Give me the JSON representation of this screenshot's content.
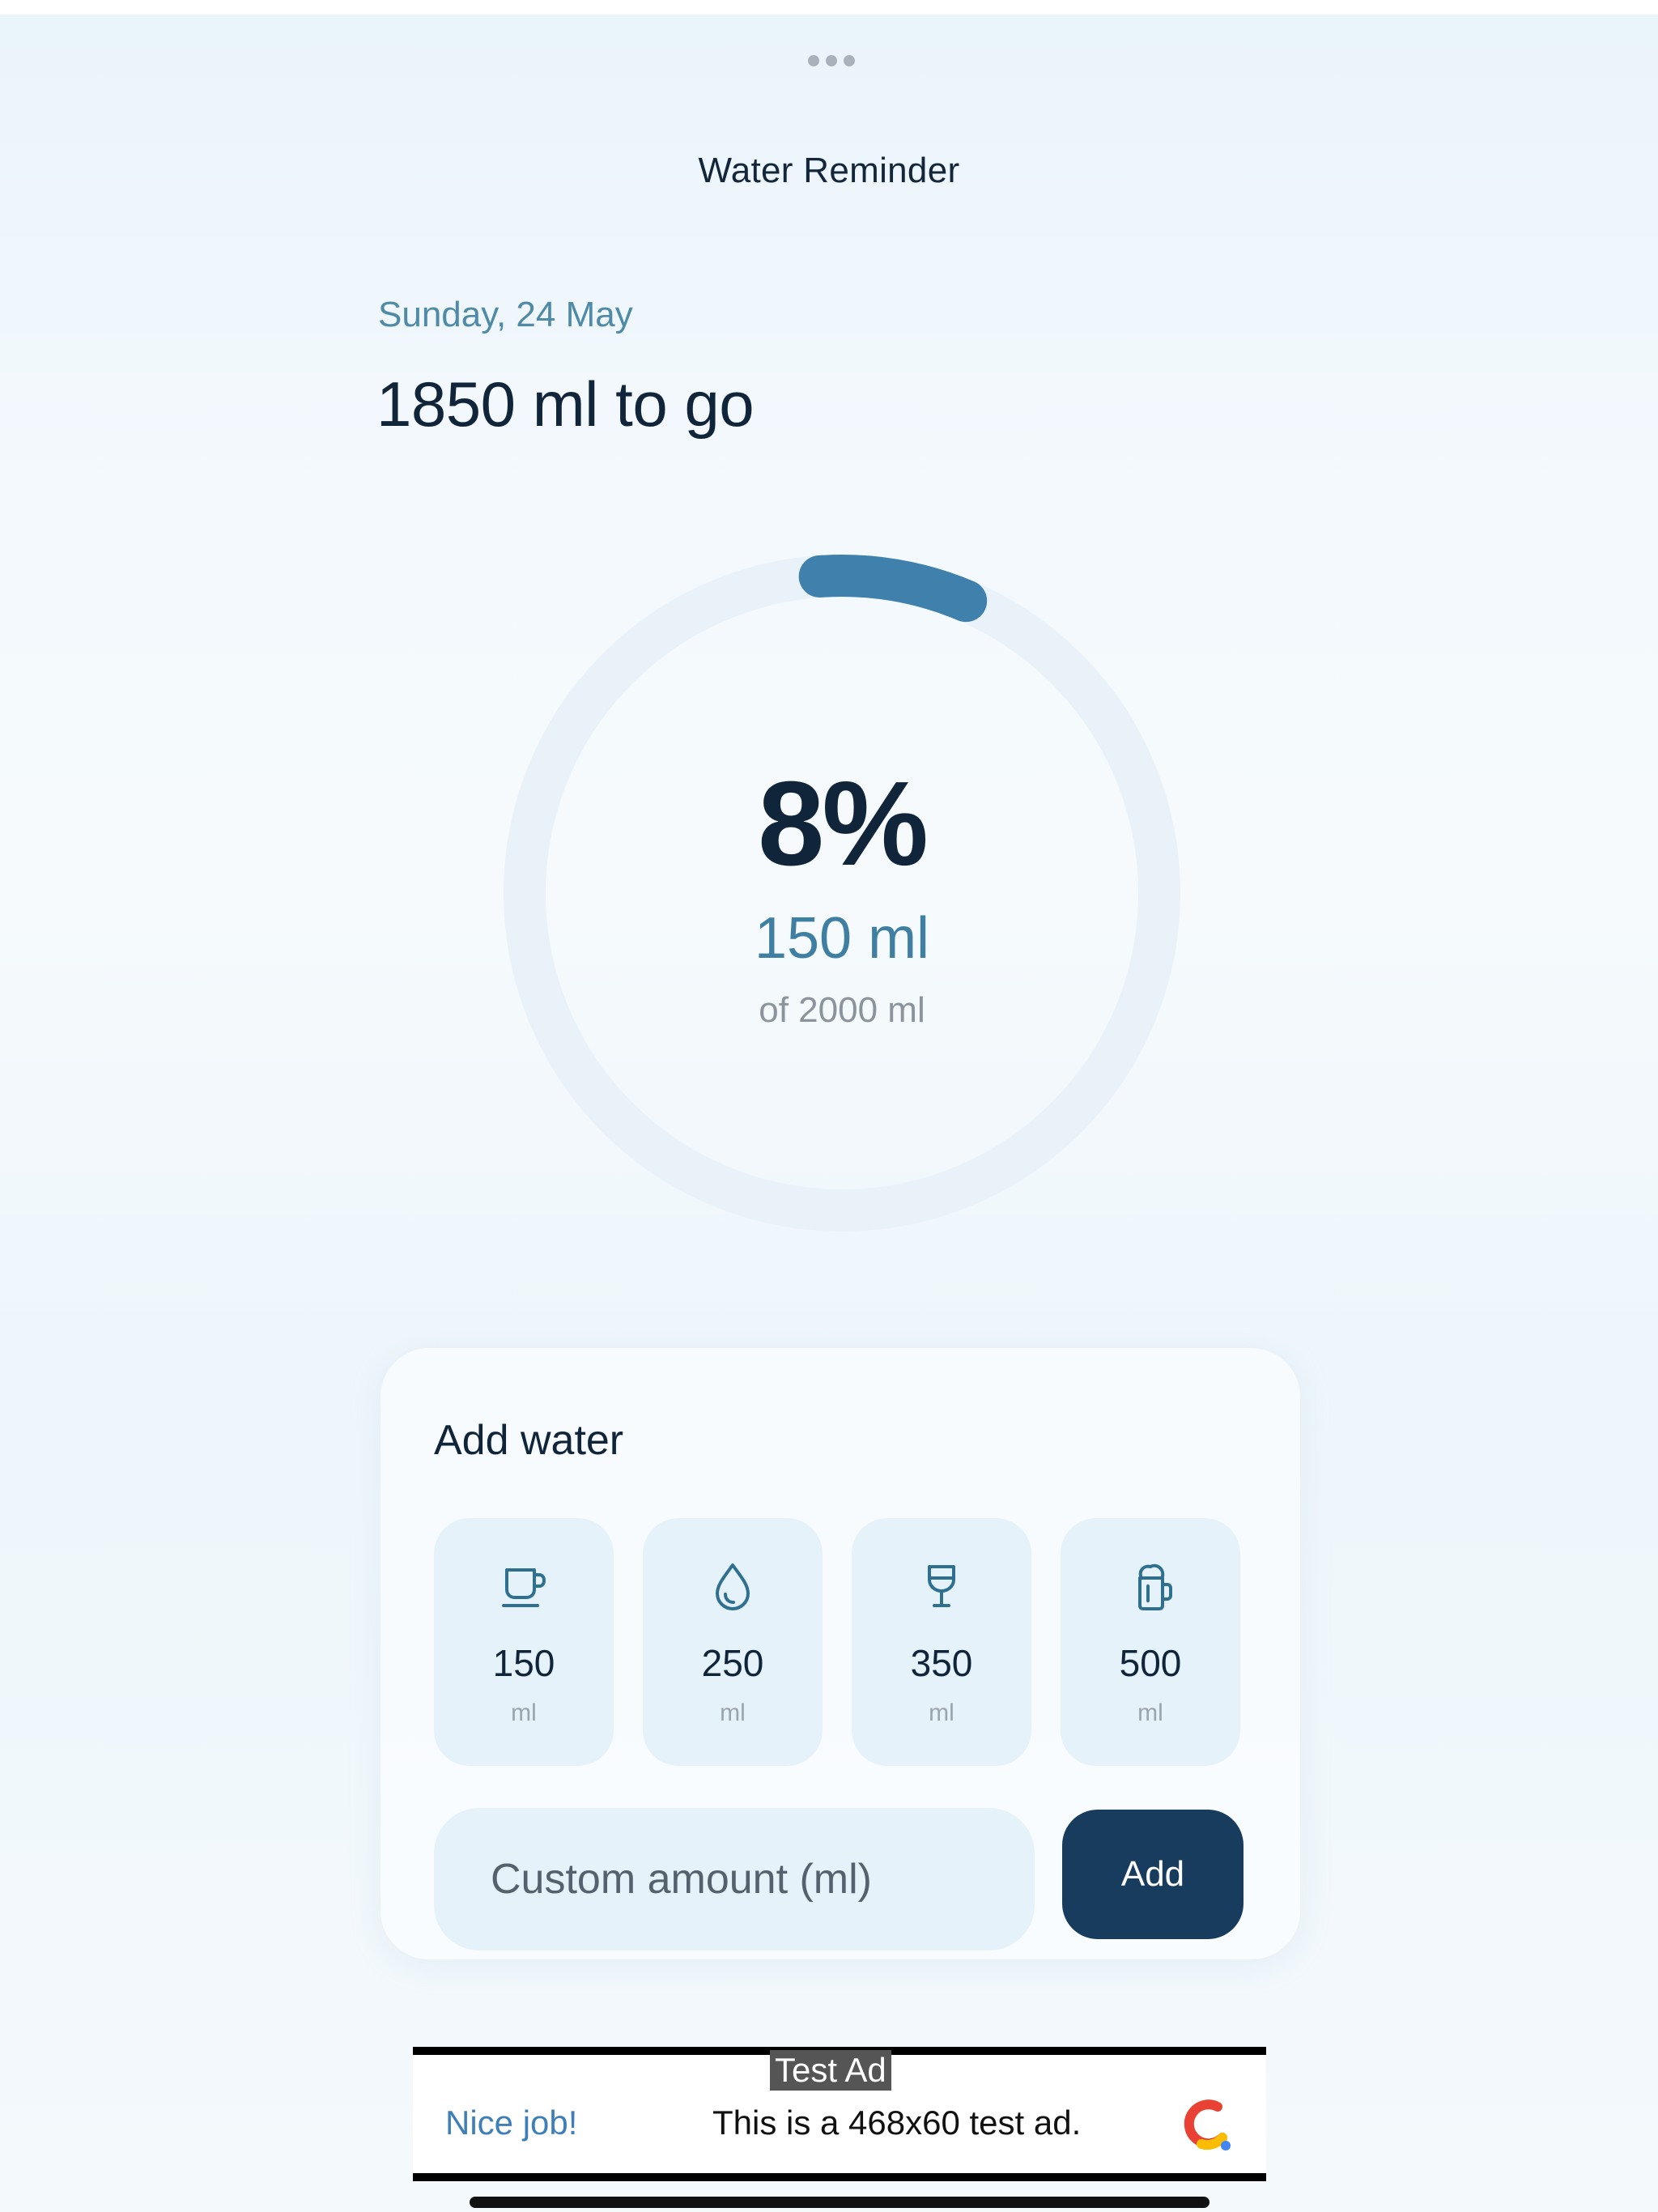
{
  "app": {
    "title": "Water Reminder",
    "menu_icon": "more-horizontal-icon"
  },
  "summary": {
    "date": "Sunday, 24 May",
    "remaining": "1850 ml to go"
  },
  "progress": {
    "percent_label": "8%",
    "fraction": 0.075,
    "consumed_label": "150 ml",
    "goal_label": "of 2000 ml"
  },
  "add_water": {
    "title": "Add water",
    "presets": [
      {
        "value": "150",
        "unit": "ml",
        "icon": "cup-icon"
      },
      {
        "value": "250",
        "unit": "ml",
        "icon": "water-drop-icon"
      },
      {
        "value": "350",
        "unit": "ml",
        "icon": "glass-icon"
      },
      {
        "value": "500",
        "unit": "ml",
        "icon": "bottle-icon"
      }
    ],
    "custom_placeholder": "Custom amount (ml)",
    "custom_value": "",
    "add_label": "Add"
  },
  "ad": {
    "badge": "Test Ad",
    "headline": "Nice job!",
    "body": "This is a 468x60 test ad.",
    "logo_icon": "ad-network-logo-icon"
  },
  "colors": {
    "accent": "#3f7fa2",
    "ring_track": "#e9f2f9",
    "button": "#173c5e",
    "tile": "#e6f2fa"
  }
}
